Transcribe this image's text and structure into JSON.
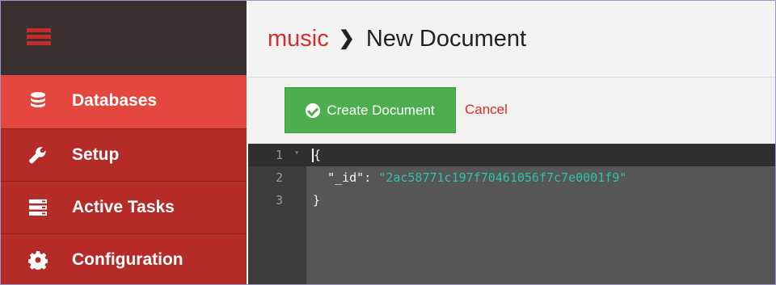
{
  "sidebar": {
    "items": [
      {
        "label": "Databases",
        "icon": "database-icon",
        "active": true
      },
      {
        "label": "Setup",
        "icon": "wrench-icon",
        "active": false
      },
      {
        "label": "Active Tasks",
        "icon": "server-icon",
        "active": false
      },
      {
        "label": "Configuration",
        "icon": "gear-icon",
        "active": false
      }
    ]
  },
  "header": {
    "database": "music",
    "separator": "❯",
    "title": "New Document"
  },
  "toolbar": {
    "create_label": "Create Document",
    "cancel_label": "Cancel"
  },
  "editor": {
    "lines": [
      {
        "num": "1",
        "text": "{"
      },
      {
        "num": "2",
        "key": "\"_id\"",
        "colon": ": ",
        "value": "\"2ac58771c197f70461056f7c7e0001f9\""
      },
      {
        "num": "3",
        "text": "}"
      }
    ]
  },
  "colors": {
    "sidebar": "#b52b27",
    "sidebar_active": "#e4473e",
    "accent": "#d3302c",
    "create_button": "#4cae4c",
    "editor_bg": "#565656",
    "json_string": "#2ec3a5"
  }
}
